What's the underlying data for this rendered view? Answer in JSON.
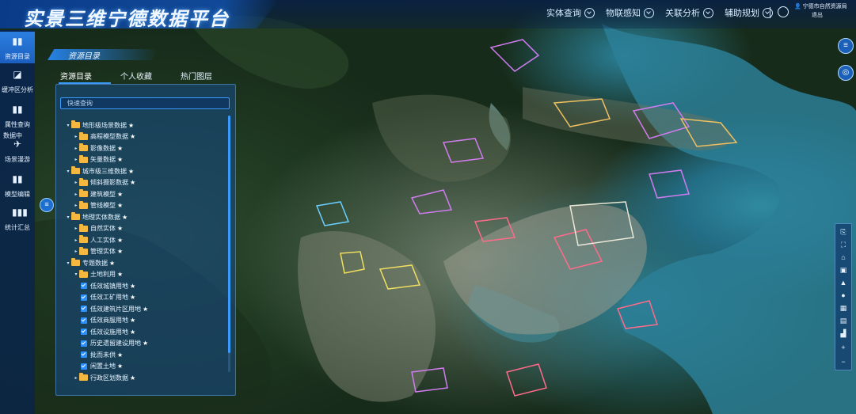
{
  "header": {
    "title": "实景三维宁德数据平台",
    "nav": [
      {
        "label": "实体查询"
      },
      {
        "label": "物联感知"
      },
      {
        "label": "关联分析"
      },
      {
        "label": "辅助规划"
      }
    ],
    "user": {
      "name": "宁德市自然资源局",
      "logout": "退出"
    }
  },
  "sidebar": {
    "items": [
      {
        "label": "资源目录",
        "icon": "book-icon",
        "active": true
      },
      {
        "label": "缓冲区分析",
        "icon": "buffer-icon"
      },
      {
        "label": "属性查询",
        "icon": "book-icon"
      },
      {
        "label": "场景漫游",
        "icon": "walk-icon"
      },
      {
        "label": "模型编辑",
        "icon": "book-icon"
      },
      {
        "label": "统计汇总",
        "icon": "bar-chart-icon"
      }
    ],
    "ghost_label": "数据中"
  },
  "panel": {
    "title": "资源目录",
    "tabs": [
      {
        "label": "资源目录",
        "active": true
      },
      {
        "label": "个人收藏"
      },
      {
        "label": "热门图层"
      }
    ],
    "search_placeholder": "快速查询",
    "tree": [
      {
        "label": "地形级场景数据",
        "level": 0,
        "type": "folder",
        "expanded": true
      },
      {
        "label": "高程模型数据",
        "level": 1,
        "type": "folder"
      },
      {
        "label": "影像数据",
        "level": 1,
        "type": "folder"
      },
      {
        "label": "矢量数据",
        "level": 1,
        "type": "folder"
      },
      {
        "label": "城市级三维数据",
        "level": 0,
        "type": "folder",
        "expanded": true
      },
      {
        "label": "倾斜摄影数据",
        "level": 1,
        "type": "folder"
      },
      {
        "label": "建筑模型",
        "level": 1,
        "type": "folder"
      },
      {
        "label": "管线模型",
        "level": 1,
        "type": "folder"
      },
      {
        "label": "地理实体数据",
        "level": 0,
        "type": "folder",
        "expanded": true
      },
      {
        "label": "自然实体",
        "level": 1,
        "type": "folder"
      },
      {
        "label": "人工实体",
        "level": 1,
        "type": "folder"
      },
      {
        "label": "管理实体",
        "level": 1,
        "type": "folder"
      },
      {
        "label": "专题数据",
        "level": 0,
        "type": "folder",
        "expanded": true
      },
      {
        "label": "土地利用",
        "level": 1,
        "type": "folder",
        "expanded": true
      },
      {
        "label": "低效城镇用地",
        "level": 2,
        "type": "checkbox"
      },
      {
        "label": "低效工矿用地",
        "level": 2,
        "type": "checkbox"
      },
      {
        "label": "低效建筑片区用地",
        "level": 2,
        "type": "checkbox"
      },
      {
        "label": "低效商服用地",
        "level": 2,
        "type": "checkbox"
      },
      {
        "label": "低效设施用地",
        "level": 2,
        "type": "checkbox"
      },
      {
        "label": "历史遗留建设用地",
        "level": 2,
        "type": "checkbox"
      },
      {
        "label": "批而未供",
        "level": 2,
        "type": "checkbox"
      },
      {
        "label": "闲置土地",
        "level": 2,
        "type": "checkbox"
      },
      {
        "label": "行政区划数据",
        "level": 1,
        "type": "folder"
      }
    ],
    "star": "★"
  },
  "right_buttons": [
    {
      "icon": "list-icon"
    },
    {
      "icon": "globe-icon"
    }
  ],
  "toolbar": [
    {
      "icon": "measure-icon"
    },
    {
      "icon": "screenshot-icon"
    },
    {
      "icon": "lock-icon"
    },
    {
      "icon": "layers-icon"
    },
    {
      "icon": "north-arrow-icon"
    },
    {
      "icon": "globe-view-icon"
    },
    {
      "icon": "grid-icon"
    },
    {
      "icon": "document-icon"
    },
    {
      "icon": "chart-icon"
    },
    {
      "icon": "zoom-in-icon",
      "glyph": "+"
    },
    {
      "icon": "zoom-out-icon",
      "glyph": "−"
    }
  ],
  "colors": {
    "accent": "#2b7fe0",
    "folder": "#f4b840",
    "panel_border": "#3a9bff"
  }
}
